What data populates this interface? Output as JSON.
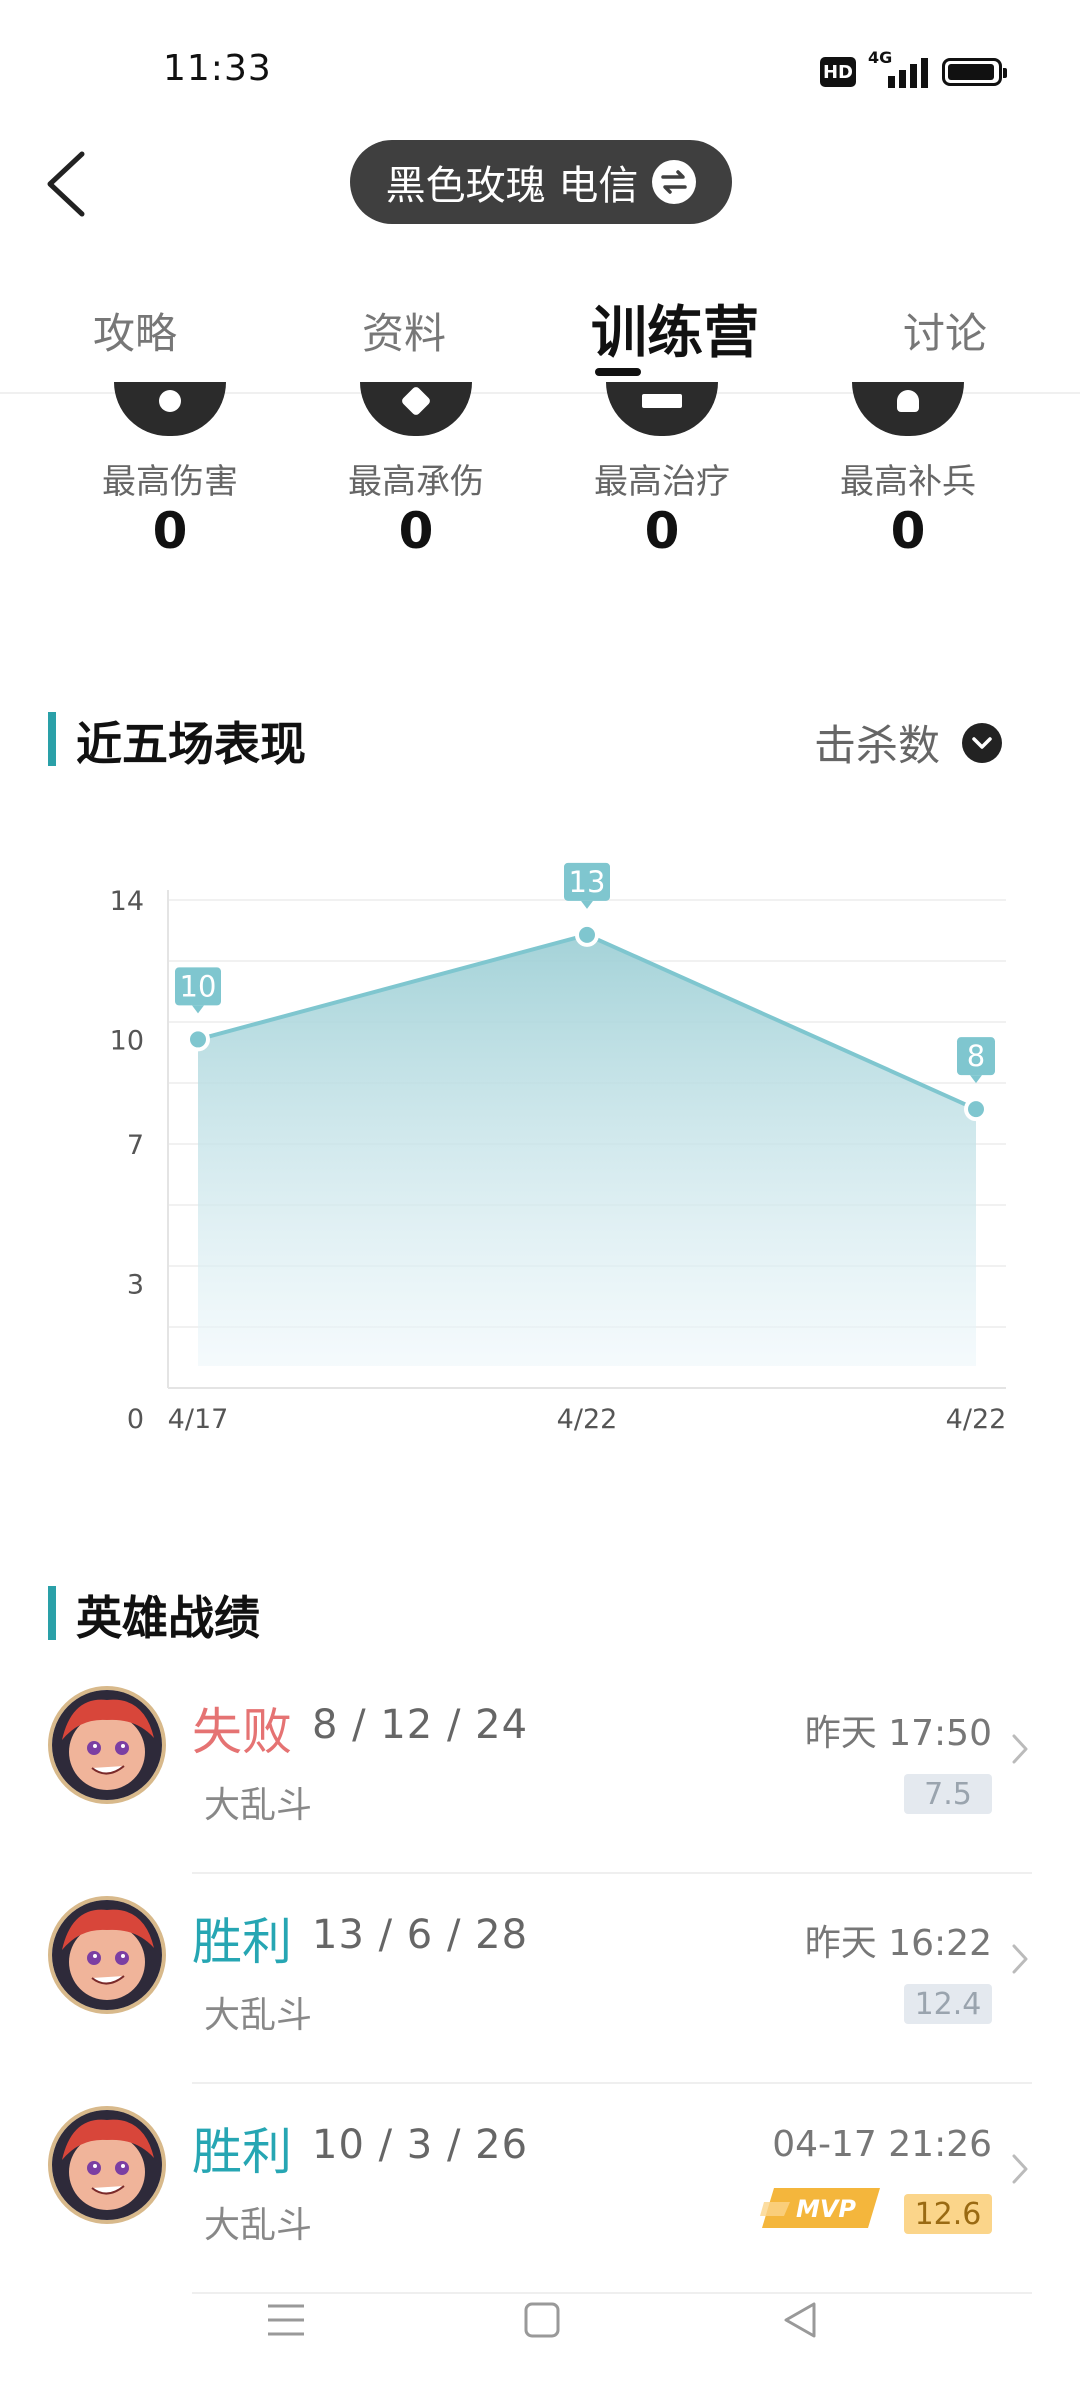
{
  "status_bar": {
    "time": "11:33",
    "hd_label": "HD",
    "network": "4G"
  },
  "header": {
    "account_label": "黑色玫瑰 电信"
  },
  "tabs": [
    {
      "label": "攻略",
      "active": false
    },
    {
      "label": "资料",
      "active": false
    },
    {
      "label": "训练营",
      "active": true
    },
    {
      "label": "讨论",
      "active": false
    }
  ],
  "stats": [
    {
      "label": "最高伤害",
      "value": "0"
    },
    {
      "label": "最高承伤",
      "value": "0"
    },
    {
      "label": "最高治疗",
      "value": "0"
    },
    {
      "label": "最高补兵",
      "value": "0"
    }
  ],
  "recent": {
    "title": "近五场表现",
    "metric": "击杀数"
  },
  "chart_data": {
    "type": "area",
    "x": [
      "4/17",
      "4/22",
      "4/22"
    ],
    "series": [
      {
        "values": [
          10,
          13,
          8
        ]
      }
    ],
    "point_labels": [
      "10",
      "13",
      "8"
    ],
    "yticks": [
      "0",
      "3",
      "7",
      "10",
      "14"
    ],
    "ylim": [
      0,
      14
    ],
    "grid": true,
    "color": "#7fc6cf"
  },
  "history": {
    "title": "英雄战绩",
    "matches": [
      {
        "result": "失败",
        "result_color": "#e57373",
        "kda": "8 / 12 / 24",
        "mode": "大乱斗",
        "time": "昨天 17:50",
        "score": "7.5",
        "score_bg": "#e4e9ef",
        "score_color": "#9aa4ae",
        "mvp": false
      },
      {
        "result": "胜利",
        "result_color": "#26a6b3",
        "kda": "13 / 6 / 28",
        "mode": "大乱斗",
        "time": "昨天 16:22",
        "score": "12.4",
        "score_bg": "#e4e9ef",
        "score_color": "#9aa4ae",
        "mvp": false
      },
      {
        "result": "胜利",
        "result_color": "#26a6b3",
        "kda": "10 / 3 / 26",
        "mode": "大乱斗",
        "time": "04-17 21:26",
        "score": "12.6",
        "score_bg": "#fbd58a",
        "score_color": "#9a6a12",
        "mvp": true,
        "mvp_label": "MVP"
      }
    ]
  },
  "colors": {
    "accent": "#2aa0a8",
    "loss": "#e57373",
    "win": "#26a6b3"
  }
}
